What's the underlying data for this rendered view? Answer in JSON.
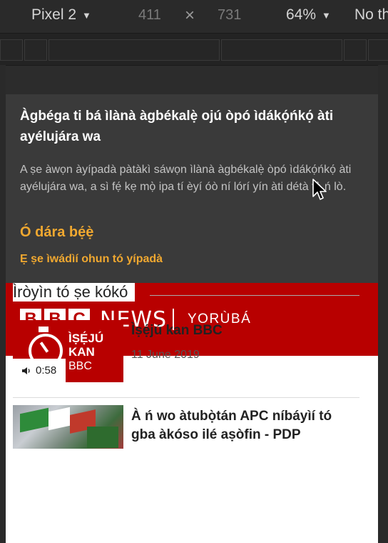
{
  "devtools": {
    "device": "Pixel 2",
    "width": "411",
    "times": "×",
    "height": "731",
    "zoom": "64%",
    "throttle": "No th"
  },
  "banner": {
    "title": "Àgbéga ti bá ìlànà àgbékalẹ̀ ojú òpó ìdákọ́ńkọ́ àti ayélujára wa",
    "body": "A ṣe àwọn àyípadà pàtàkì sáwọn ìlànà àgbékalẹ̀ òpó ìdákọ́ńkọ́ àti ayélujára wa, a sì fẹ́ kẹ mọ̀ ipa tí èyí óò ní lórí yín àti détà tẹ̀ ń lò.",
    "cta": "Ó dára bẹ́ẹ̀",
    "link": "Ẹ ṣe ìwádìí ohun tó yípadà"
  },
  "masthead": {
    "logo_letters": [
      "B",
      "B",
      "C"
    ],
    "news": "NEWS",
    "lang": "YORÙBÁ",
    "color": "#b80000"
  },
  "section": {
    "title": "Ìròyìn tó ṣe kókó"
  },
  "stories": [
    {
      "title": "Ìṣẹ́jú kan BBC",
      "date": "11 June 2019",
      "thumb_label": "ÌṢẸ́JÚ KAN",
      "thumb_brand": "BBC",
      "duration": "0:58",
      "icon": "speaker-icon"
    },
    {
      "title": "À ń wo àtubọ̀tán APC níbáyìí tó gba àkóso ilé aṣòfin - PDP"
    }
  ]
}
